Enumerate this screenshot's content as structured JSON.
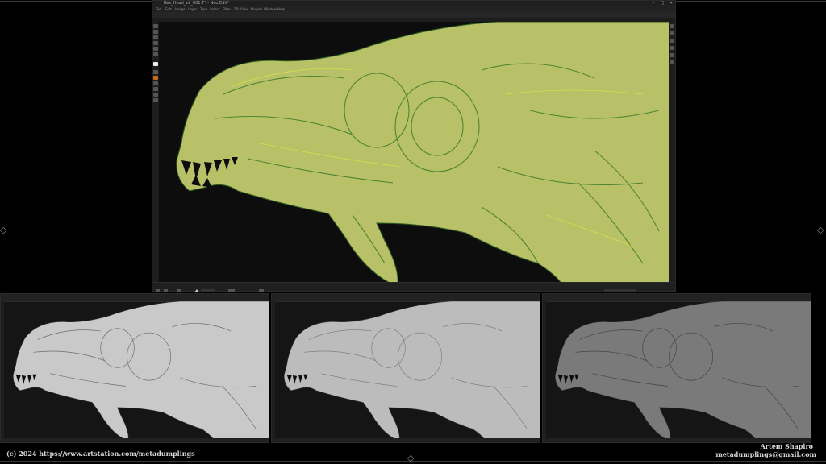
{
  "main_window": {
    "title": "Rex_Head_v2_001.T* - Neo Edit*",
    "menu": [
      "File",
      "Edit",
      "Image",
      "Layer",
      "Type",
      "Select",
      "Filter",
      "3D",
      "View",
      "Plugins",
      "Window",
      "Help"
    ],
    "controls": {
      "minimize": "–",
      "maximize": "□",
      "close": "✕"
    }
  },
  "theme": {
    "main_fill": "#b9c168",
    "main_stroke": "#3c7a2a",
    "main_highlight": "#e6ee3a",
    "gray_light": "#c9c9c9",
    "gray_mid": "#bcbcbc",
    "gray_dark": "#7a7a7a",
    "stroke_gray": "#555555"
  },
  "icons": {
    "frame_ornament": "diamond-ornament",
    "corner": "corner-bracket"
  },
  "previews": [
    {
      "name": "preview-1",
      "tone": "light"
    },
    {
      "name": "preview-2",
      "tone": "mid"
    },
    {
      "name": "preview-3",
      "tone": "dark"
    }
  ],
  "credits": {
    "copyright": "(c) 2024 https://www.artstation.com/metadumplings",
    "artist": "Artem Shapiro",
    "email": "metadumplings@gmail.com"
  }
}
